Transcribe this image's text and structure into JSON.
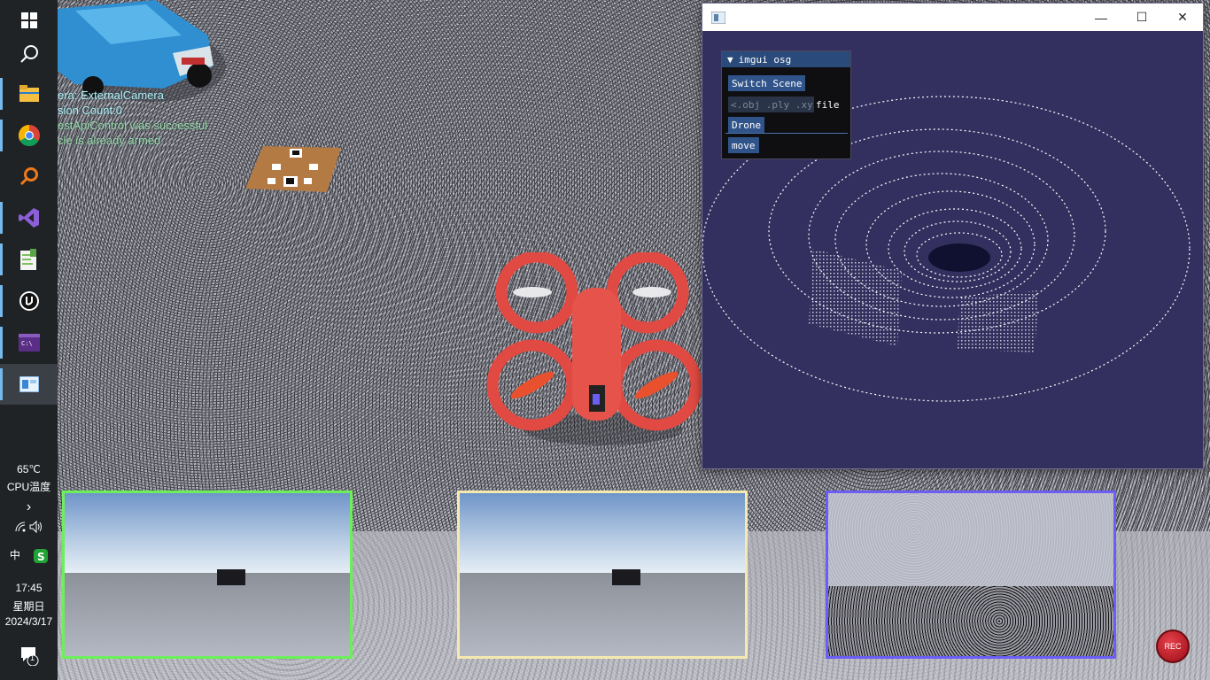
{
  "taskbar": {
    "apps": [
      {
        "name": "start-button",
        "icon": "windows-logo-icon"
      },
      {
        "name": "search-button",
        "icon": "search-icon"
      },
      {
        "name": "file-explorer-button",
        "icon": "folder-icon"
      },
      {
        "name": "chrome-button",
        "icon": "chrome-icon"
      },
      {
        "name": "search-everything-button",
        "icon": "magnifier-icon"
      },
      {
        "name": "visual-studio-button",
        "icon": "visual-studio-icon"
      },
      {
        "name": "notepad-plus-button",
        "icon": "notepad-icon"
      },
      {
        "name": "unreal-engine-button",
        "icon": "unreal-icon"
      },
      {
        "name": "terminal-button",
        "icon": "terminal-icon"
      },
      {
        "name": "osg-app-button",
        "icon": "window-app-icon"
      }
    ],
    "cpu_temp": "65℃",
    "cpu_label": "CPU温度",
    "time": "17:45",
    "weekday": "星期日",
    "date": "2024/3/17",
    "ime": "中",
    "notification_count": "1"
  },
  "hud": {
    "lines": [
      "era: ExternalCamera",
      "sion Count:0",
      "estApiControl was successful",
      "cle is already armed"
    ]
  },
  "osg_window": {
    "title": "",
    "panel": {
      "header": "imgui osg",
      "switch_scene": "Switch Scene",
      "file_placeholder": "<.obj .ply .xyz",
      "file_label": "file",
      "drone_header": "Drone",
      "move_button": "move"
    }
  },
  "rec_label": "REC",
  "colors": {
    "cam1_border": "#6cf05a",
    "cam2_border": "#f5e9b0",
    "cam3_border": "#6b5ef5",
    "osg_background": "#33305f",
    "drone": "#e04a42"
  }
}
